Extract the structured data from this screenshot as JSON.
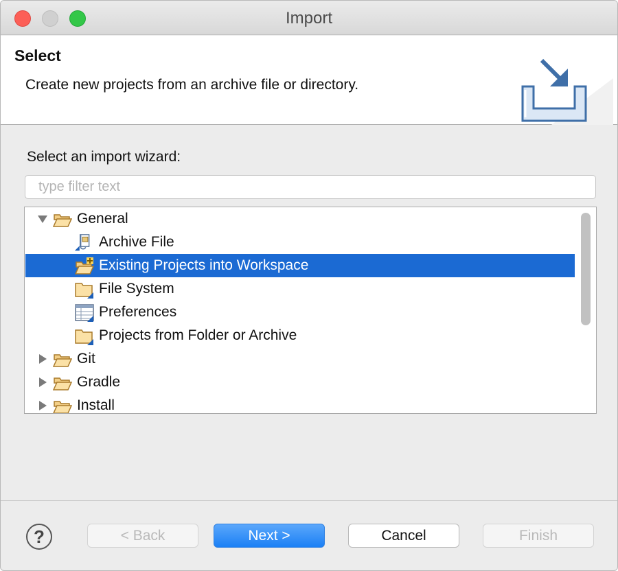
{
  "window": {
    "title": "Import"
  },
  "banner": {
    "title": "Select",
    "description": "Create new projects from an archive file or directory.",
    "icon": "import-wizard-icon"
  },
  "content": {
    "prompt": "Select an import wizard:",
    "filter": {
      "placeholder": "type filter text",
      "value": ""
    }
  },
  "tree": {
    "items": [
      {
        "label": "General",
        "level": 0,
        "expanded": true,
        "icon": "open-folder-icon"
      },
      {
        "label": "Archive File",
        "level": 1,
        "icon": "archive-file-icon"
      },
      {
        "label": "Existing Projects into Workspace",
        "level": 1,
        "icon": "new-project-folder-icon",
        "selected": true
      },
      {
        "label": "File System",
        "level": 1,
        "icon": "folder-icon"
      },
      {
        "label": "Preferences",
        "level": 1,
        "icon": "preferences-icon"
      },
      {
        "label": "Projects from Folder or Archive",
        "level": 1,
        "icon": "folder-icon"
      },
      {
        "label": "Git",
        "level": 0,
        "expanded": false,
        "icon": "open-folder-icon"
      },
      {
        "label": "Gradle",
        "level": 0,
        "expanded": false,
        "icon": "open-folder-icon"
      },
      {
        "label": "Install",
        "level": 0,
        "expanded": false,
        "icon": "open-folder-icon"
      }
    ]
  },
  "footer": {
    "help": "?",
    "back_label": "< Back",
    "next_label": "Next >",
    "cancel_label": "Cancel",
    "finish_label": "Finish"
  },
  "colors": {
    "selection": "#1b6ad3",
    "primary_button": "#1b80f5",
    "close": "#fc5f57",
    "maximize": "#33c748"
  }
}
